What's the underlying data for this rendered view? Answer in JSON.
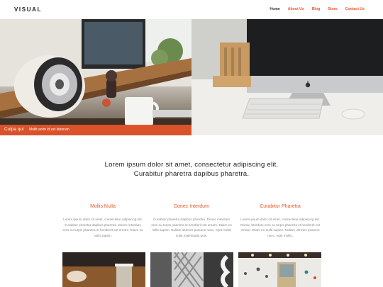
{
  "header": {
    "logo": "VISUAL",
    "nav": [
      {
        "label": "Home",
        "active": true
      },
      {
        "label": "About Us",
        "active": false
      },
      {
        "label": "Blog",
        "active": false
      },
      {
        "label": "Store",
        "active": false
      },
      {
        "label": "Contact Us",
        "active": false
      }
    ]
  },
  "hero": {
    "caption_title": "Culpa qui",
    "caption_subtitle": "Mollit anim id est laborum"
  },
  "tagline": {
    "line1": "Lorem ipsum dolor sit amet, consectetur adipiscing elit.",
    "line2": "Curabitur pharetra dapibus pharetra."
  },
  "features": [
    {
      "title": "Mollis Nulla",
      "text": "Lorem ipsum dolor sit amet, consectetur adipiscing elit. Curabitur pharetra dapibus pharetra. Donec interdum eros eu turpis pharetra et hendrerit est ornare. Etiam eu nulla sapien."
    },
    {
      "title": "Donec Interdum",
      "text": "Curabitur pharetra dapibus pharetra. Donec interdum eros eu turpis pharetra et hendrerit est ornare. Etiam eu nulla sapien. Nullam ultricies posuere nunc, eget mollis nulla malesuada quis."
    },
    {
      "title": "Curabitur Pharetra",
      "text": "Lorem ipsum dolor sit amet, consectetur adipiscing elit. Donec interdum eros eu turpis pharetra et hendrerit est ornare. Etiam eu nulla sapien. Nullam ultricies posuere nunc, eget mollis."
    }
  ],
  "colors": {
    "accent": "#e8562a",
    "text": "#222222",
    "muted": "#888888"
  },
  "icons": {
    "apple_logo": "apple-logo-icon"
  }
}
